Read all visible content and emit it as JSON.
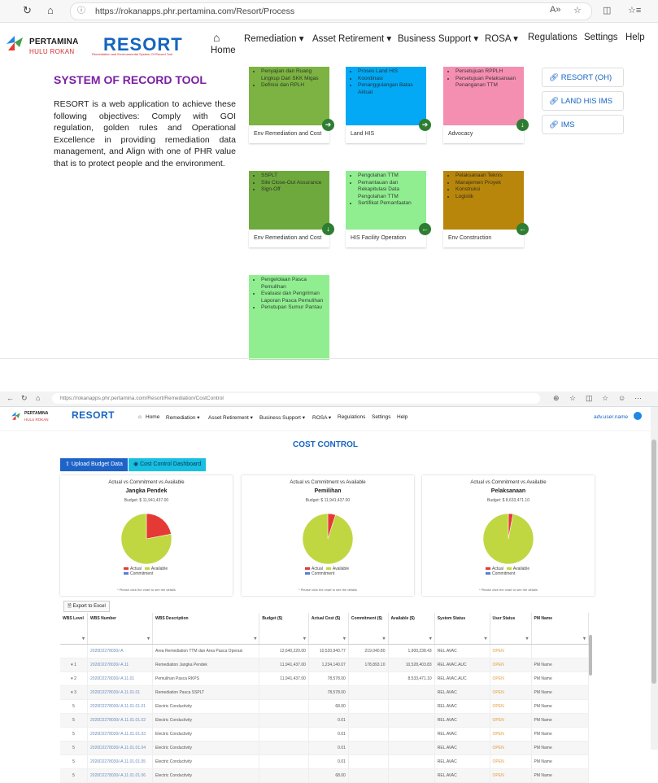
{
  "top": {
    "browser": {
      "url": "https://rokanapps.phr.pertamina.com/Resort/Process",
      "read_aloud": "A»"
    },
    "logo": {
      "name": "PERTAMINA",
      "sub": "HULU ROKAN"
    },
    "app_name": "RESORT",
    "app_tagline": "Remediation and Environmental System Of Record Tool",
    "nav": {
      "home": "Home",
      "remediation": "Remediation ▾",
      "asset_retirement": "Asset Retirement ▾",
      "business_support": "Business Support ▾",
      "rosa": "ROSA ▾",
      "regulations": "Regulations",
      "settings": "Settings",
      "help": "Help"
    },
    "heading": "SYSTEM OF RECORD TOOL",
    "description": "RESORT is a web application to achieve these following objectives: Comply with GOI regulation, golden rules and Operational Excellence in providing remediation data management, and Align with one of PHR value that is to protect people and the environment.",
    "cards": [
      {
        "color": "#7cb342",
        "items": [
          "Penyajian dan Ruang Lingkup Dari SKK Migas",
          "Definisi dan RPLH"
        ],
        "label": "Env Remediation and Cost",
        "icon": "➔",
        "icon_bg": "#2e7d32"
      },
      {
        "color": "#03a9f4",
        "items": [
          "Proses Land HIS",
          "Koordinasi",
          "Penanggulangan Batas Aktual"
        ],
        "label": "Land HIS",
        "icon": "➔",
        "icon_bg": "#2e7d32"
      },
      {
        "color": "#f48fb1",
        "items": [
          "Persetujuan RPPLH",
          "Persetujuan Pelaksanaan Penanganan TTM"
        ],
        "label": "Advocacy",
        "icon": "↓",
        "icon_bg": "#2e7d32"
      },
      {
        "color": "#6ea93d",
        "items": [
          "SSPLT",
          "Site Close-Out Assurance",
          "Sign-Off"
        ],
        "label": "Env Remediation and Cost",
        "icon": "↓",
        "icon_bg": "#2e7d32"
      },
      {
        "color": "#90ee90",
        "items": [
          "Pengolahan TTM",
          "Pemantauan dan Rekapitulasi Data Pengolahan TTM",
          "Sertifikat Pemanfaatan"
        ],
        "label": "HIS Facility Operation",
        "icon": "←",
        "icon_bg": "#2e7d32"
      },
      {
        "color": "#b8860b",
        "items": [
          "Pelaksanaan Teknis",
          "Manajemen Proyek",
          "Konstruksi",
          "Logistik"
        ],
        "label": "Env Construction",
        "icon": "←",
        "icon_bg": "#2e7d32"
      },
      {
        "color": "#90ee90",
        "items": [
          "Pengelolaan Pasca Pemulihan",
          "Evaluasi dan Pengiriman Laporan Pasca Pemulihan",
          "Penutupan Sumur Pantau"
        ],
        "label": "",
        "icon": "",
        "icon_bg": ""
      }
    ],
    "quick_links": [
      "RESORT (OH)",
      "LAND HIS IMS",
      "IMS"
    ]
  },
  "bottom": {
    "browser": {
      "url": "https://rokanapps.phr.pertamina.com/Resort/Remediation/CostControl"
    },
    "app_name": "RESORT",
    "user": "adv.user.name",
    "nav": {
      "home": "Home",
      "remediation": "Remediation ▾",
      "asset_retirement": "Asset Retirement ▾",
      "business_support": "Business Support ▾",
      "rosa": "ROSA ▾",
      "regulations": "Regulations",
      "settings": "Settings",
      "help": "Help"
    },
    "page_title": "COST CONTROL",
    "buttons": {
      "upload": "Upload Budget Data",
      "dashboard": "Cost Control Dashboard"
    },
    "chart_data": [
      {
        "type": "pie",
        "title": "Actual vs Commitment vs Available",
        "subtitle": "Jangka Pendek",
        "budget": "Budget: $ 11,941,437.00",
        "legend": [
          "Actual",
          "Available",
          "Commitment"
        ],
        "values": [
          22,
          78,
          0
        ],
        "colors": [
          "#e53935",
          "#c0d742",
          "#5b7fd6"
        ]
      },
      {
        "type": "pie",
        "title": "Actual vs Commitment vs Available",
        "subtitle": "Pemilihan",
        "budget": "Budget: $ 11,941,437.00",
        "legend": [
          "Actual",
          "Available",
          "Commitment"
        ],
        "values": [
          5,
          95,
          0
        ],
        "colors": [
          "#e53935",
          "#c0d742",
          "#5b7fd6"
        ]
      },
      {
        "type": "pie",
        "title": "Actual vs Commitment vs Available",
        "subtitle": "Pelaksanaan",
        "budget": "Budget: $ 8,633,471.10",
        "legend": [
          "Actual",
          "Available",
          "Commitment"
        ],
        "values": [
          3,
          97,
          0
        ],
        "colors": [
          "#e53935",
          "#c0d742",
          "#5b7fd6"
        ]
      }
    ],
    "chart_note": "* Please click the chart to see the details",
    "export_label": "Export to Excel",
    "table": {
      "headers": [
        "WBS Level",
        "WBS Number",
        "WBS Description",
        "Budget ($)",
        "Actual Cost ($)",
        "Commitment ($)",
        "Available ($)",
        "System Status",
        "User Status",
        "PM Name"
      ],
      "rows": [
        [
          "",
          "2020D2278030/-A",
          "Area Remediation TTM dan Area Pasca Operasi",
          "12,640,220.00",
          "10,520,940.77",
          "219,040.80",
          "1,900,238.43",
          "REL.AVAC",
          "OPEN",
          ""
        ],
        [
          "▾ 1",
          "2020D2278030/-A.11",
          "Remediation Jangka Pendek",
          "11,941,437.00",
          "1,234,140.07",
          "178,893.10",
          "10,528,403.83",
          "REL.AVAC.AUC",
          "OPEN",
          "PM Name"
        ],
        [
          "▾ 2",
          "2020D2278030/-A.11.01",
          "Pemulihan Pasca RKPS",
          "11,941,437.00",
          "78,578.00",
          "",
          "8,533,471.10",
          "REL.AVAC.AUC",
          "OPEN",
          "PM Name"
        ],
        [
          "▾ 3",
          "2020D2278030/-A.11.01.01",
          "Remediation Pasca SSPLT",
          "",
          "78,578.00",
          "",
          "",
          "REL.AVAC",
          "OPEN",
          "PM Name"
        ],
        [
          "5",
          "2020D2278030/-A.11.01.01.01",
          "Electric Conductivity",
          "",
          "68.00",
          "",
          "",
          "REL.AVAC",
          "OPEN",
          "PM Name"
        ],
        [
          "5",
          "2020D2278030/-A.11.01.01.02",
          "Electric Conductivity",
          "",
          "0.01",
          "",
          "",
          "REL.AVAC",
          "OPEN",
          "PM Name"
        ],
        [
          "5",
          "2020D2278030/-A.11.01.01.03",
          "Electric Conductivity",
          "",
          "0.01",
          "",
          "",
          "REL.AVAC",
          "OPEN",
          "PM Name"
        ],
        [
          "5",
          "2020D2278030/-A.11.01.01.04",
          "Electric Conductivity",
          "",
          "0.01",
          "",
          "",
          "REL.AVAC",
          "OPEN",
          "PM Name"
        ],
        [
          "5",
          "2020D2278030/-A.11.01.01.05",
          "Electric Conductivity",
          "",
          "0.01",
          "",
          "",
          "REL.AVAC",
          "OPEN",
          "PM Name"
        ],
        [
          "5",
          "2020D2278030/-A.11.01.01.06",
          "Electric Conductivity",
          "",
          "68.00",
          "",
          "",
          "REL.AVAC",
          "OPEN",
          "PM Name"
        ]
      ]
    }
  }
}
